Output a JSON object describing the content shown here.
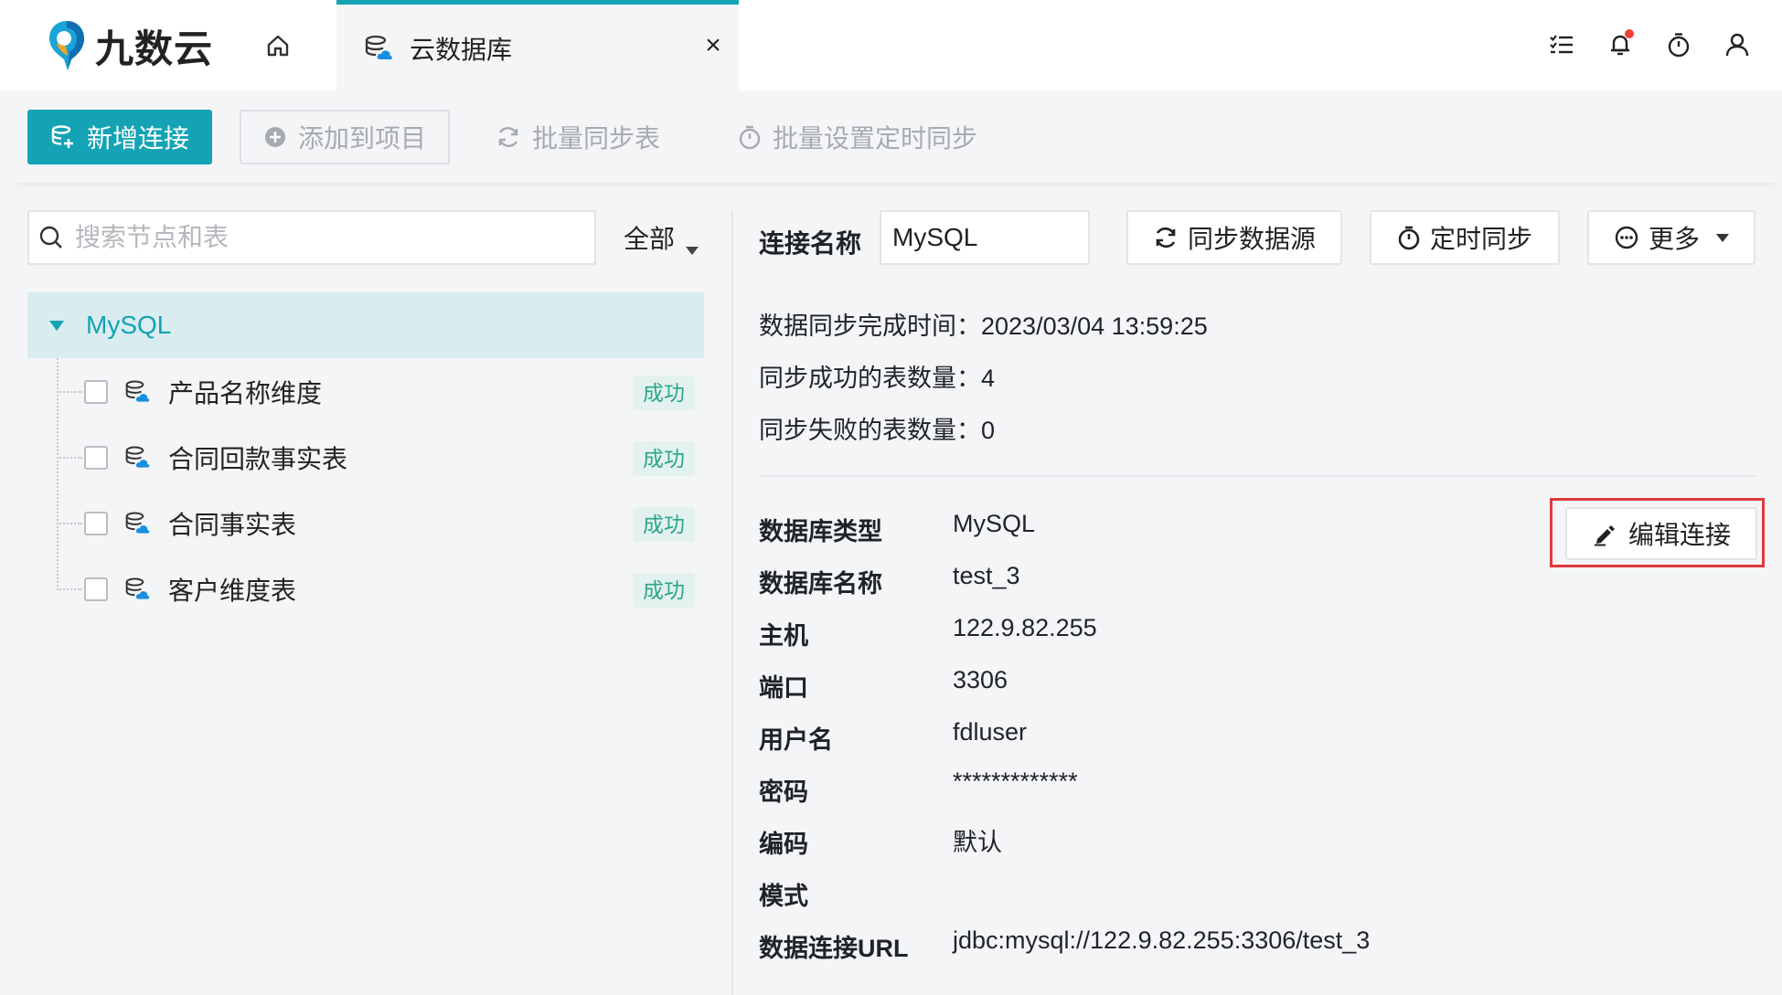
{
  "app": {
    "logo_text": "九数云",
    "brand_color": "#13a3b5"
  },
  "tabs": {
    "home_icon": "home-icon",
    "active": {
      "label": "云数据库",
      "icon": "cloud-database-icon",
      "close": "×"
    }
  },
  "top_icons": [
    "task-list-icon",
    "bell-icon",
    "timer-icon",
    "user-icon"
  ],
  "toolbar": {
    "new_connection": "新增连接",
    "add_to_project": "添加到项目",
    "batch_sync": "批量同步表",
    "batch_schedule": "批量设置定时同步"
  },
  "left": {
    "search_placeholder": "搜索节点和表",
    "filter": "全部",
    "root": "MySQL",
    "items": [
      {
        "label": "产品名称维度",
        "status": "成功"
      },
      {
        "label": "合同回款事实表",
        "status": "成功"
      },
      {
        "label": "合同事实表",
        "status": "成功"
      },
      {
        "label": "客户维度表",
        "status": "成功"
      }
    ]
  },
  "detail": {
    "conn_name_label": "连接名称",
    "conn_name_value": "MySQL",
    "sync_source": "同步数据源",
    "scheduled_sync": "定时同步",
    "more": "更多",
    "sync_time": "数据同步完成时间：2023/03/04 13:59:25",
    "sync_success": "同步成功的表数量：4",
    "sync_fail": "同步失败的表数量：0",
    "edit_connection": "编辑连接",
    "props": [
      {
        "label": "数据库类型",
        "value": "MySQL"
      },
      {
        "label": "数据库名称",
        "value": "test_3"
      },
      {
        "label": "主机",
        "value": "122.9.82.255"
      },
      {
        "label": "端口",
        "value": "3306"
      },
      {
        "label": "用户名",
        "value": "fdluser"
      },
      {
        "label": "密码",
        "value": "*************"
      },
      {
        "label": "编码",
        "value": "默认"
      },
      {
        "label": "模式",
        "value": ""
      },
      {
        "label": "数据连接URL",
        "value": "jdbc:mysql://122.9.82.255:3306/test_3"
      }
    ]
  }
}
